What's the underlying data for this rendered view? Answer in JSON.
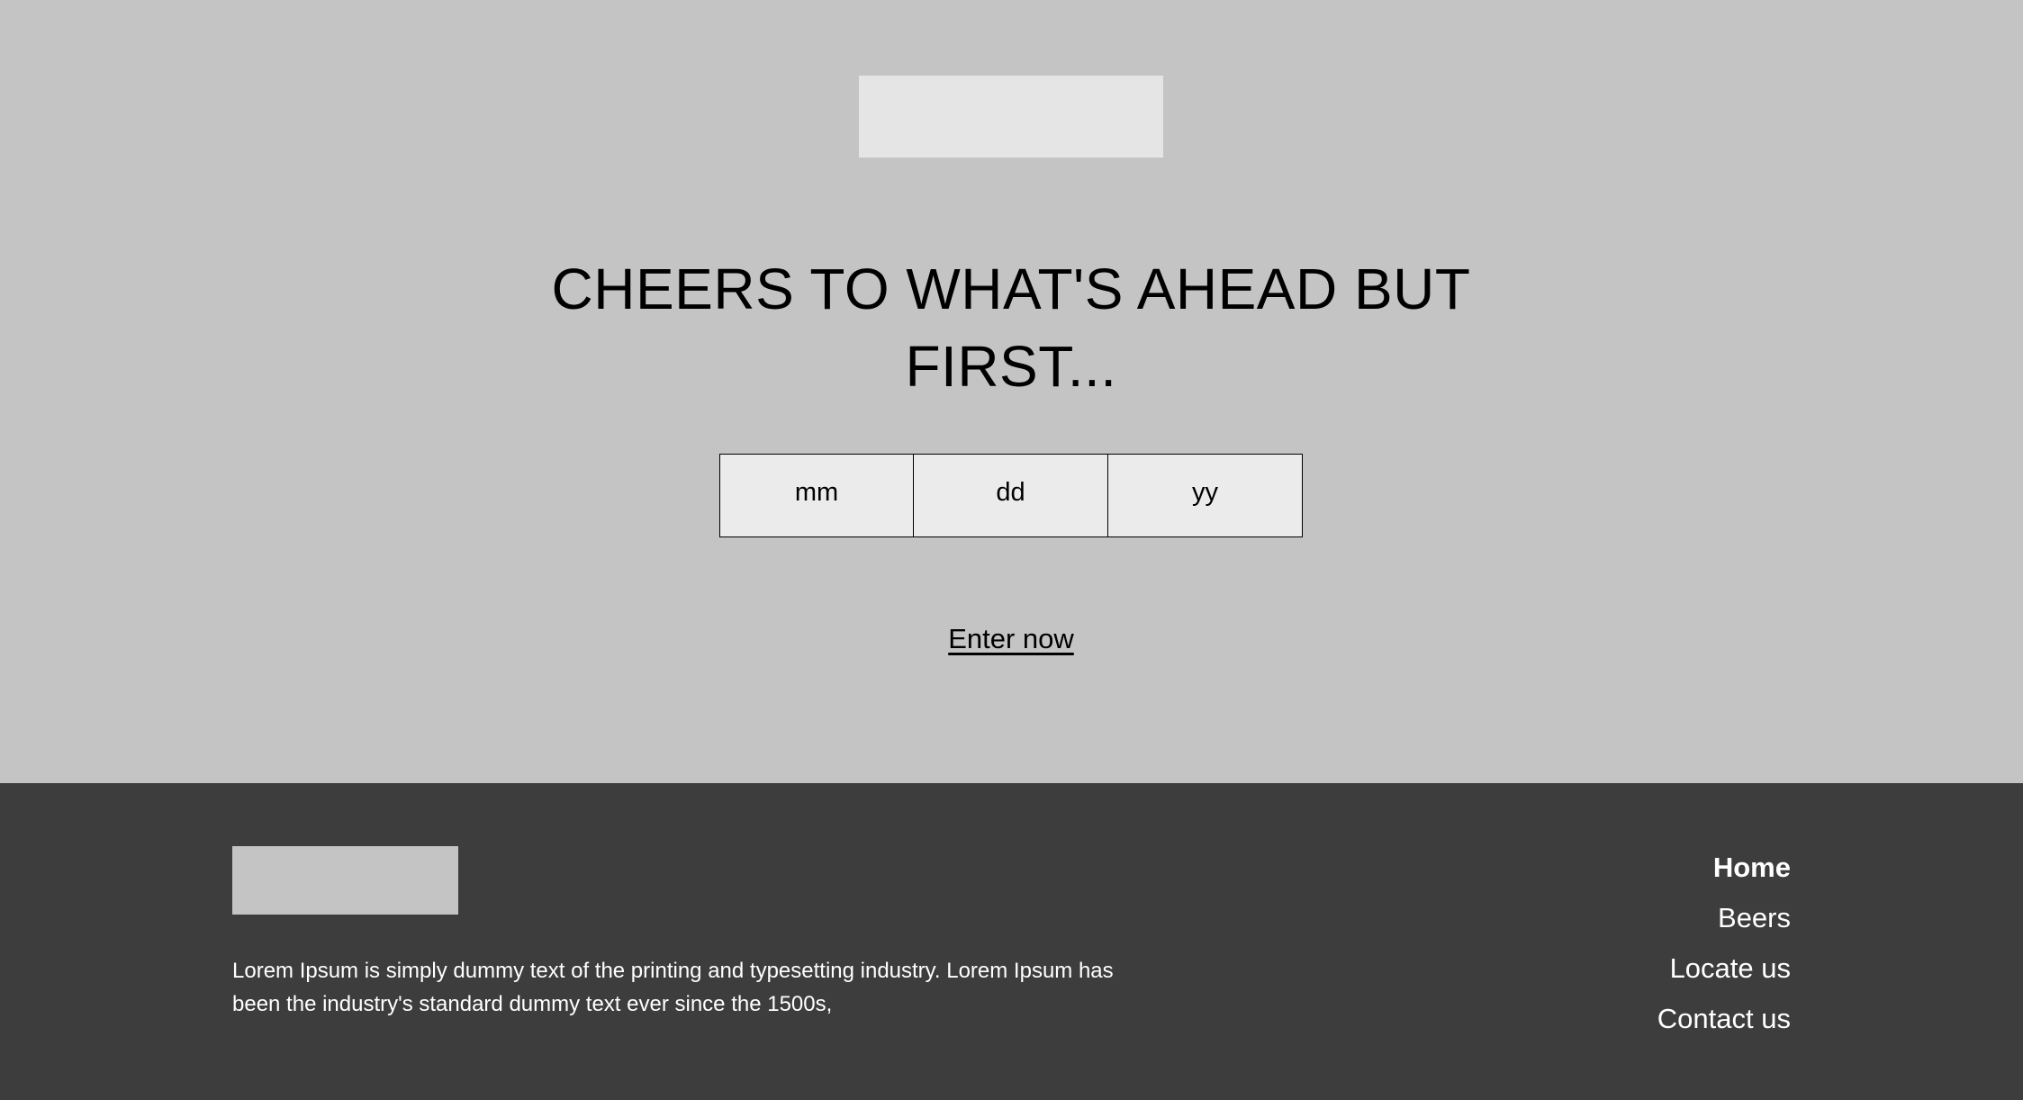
{
  "hero": {
    "headline_line1": "CHEERS TO WHAT'S AHEAD BUT",
    "headline_line2": "FIRST...",
    "date_fields": [
      {
        "placeholder": "mm"
      },
      {
        "placeholder": "dd"
      },
      {
        "placeholder": "yy"
      }
    ],
    "enter_label": "Enter now"
  },
  "footer": {
    "description": "Lorem Ipsum is simply dummy text of the printing and typesetting industry. Lorem Ipsum has been the industry's standard dummy text ever since the 1500s,",
    "nav": [
      {
        "label": "Home",
        "active": true
      },
      {
        "label": "Beers",
        "active": false
      },
      {
        "label": "Locate us",
        "active": false
      },
      {
        "label": "Contact us",
        "active": false
      }
    ]
  },
  "colors": {
    "hero_bg": "#c4c4c4",
    "footer_bg": "#3d3d3d",
    "placeholder_light": "#e5e5e5",
    "field_bg": "#ebebeb"
  }
}
